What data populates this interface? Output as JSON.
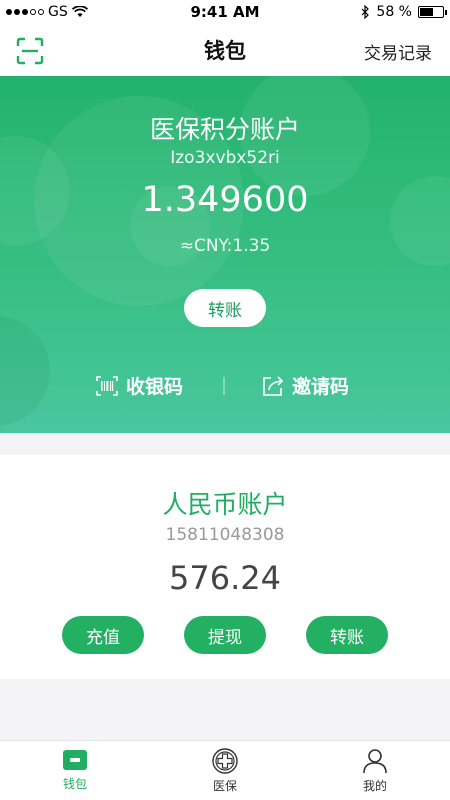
{
  "status_bar": {
    "carrier": "GS",
    "time": "9:41 AM",
    "battery_percent": "58 %",
    "battery_level": 0.58
  },
  "nav": {
    "title": "钱包",
    "history_label": "交易记录",
    "scan_icon": "scan-icon"
  },
  "points_account": {
    "title": "医保积分账户",
    "account_id": "Izo3xvbx52ri",
    "balance": "1.349600",
    "cny_equivalent": "≈CNY:1.35",
    "transfer_label": "转账",
    "receive_code_label": "收银码",
    "invite_code_label": "邀请码",
    "colors": {
      "gradient_top": "#23b26d",
      "gradient_bottom": "#49c69f"
    }
  },
  "rmb_account": {
    "title": "人民币账户",
    "phone": "15811048308",
    "balance": "576.24",
    "buttons": {
      "recharge": "充值",
      "withdraw": "提现",
      "transfer": "转账"
    },
    "accent_color": "#1fae62"
  },
  "tab_bar": {
    "tabs": [
      {
        "label": "钱包",
        "icon": "wallet-icon",
        "active": true
      },
      {
        "label": "医保",
        "icon": "medical-cross-icon",
        "active": false
      },
      {
        "label": "我的",
        "icon": "person-icon",
        "active": false
      }
    ]
  }
}
